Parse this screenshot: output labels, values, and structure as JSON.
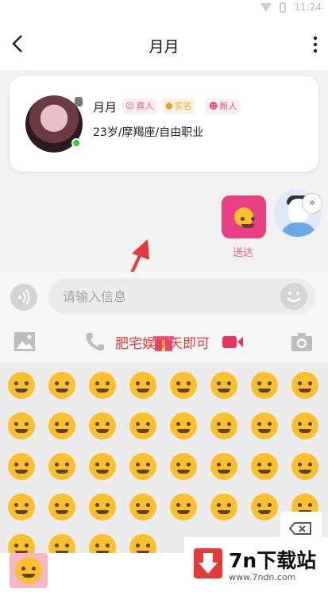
{
  "status_bar": {
    "time": "11:24"
  },
  "header": {
    "title": "月月"
  },
  "profile": {
    "name": "月月",
    "badges": {
      "real": "真人",
      "verified": "实名",
      "new": "新人"
    },
    "info": "23岁/摩羯座/自由职业"
  },
  "messages": {
    "sent_label": "送达"
  },
  "input": {
    "placeholder": "请输入信息"
  },
  "overlay": {
    "text": "肥宅娱聊天即可"
  },
  "watermark": {
    "brand": "7n下载站",
    "url": "www.7ndn.com"
  },
  "colors": {
    "accent": "#e83e83",
    "online": "#2ecc40",
    "annotation": "#e23b3b"
  }
}
